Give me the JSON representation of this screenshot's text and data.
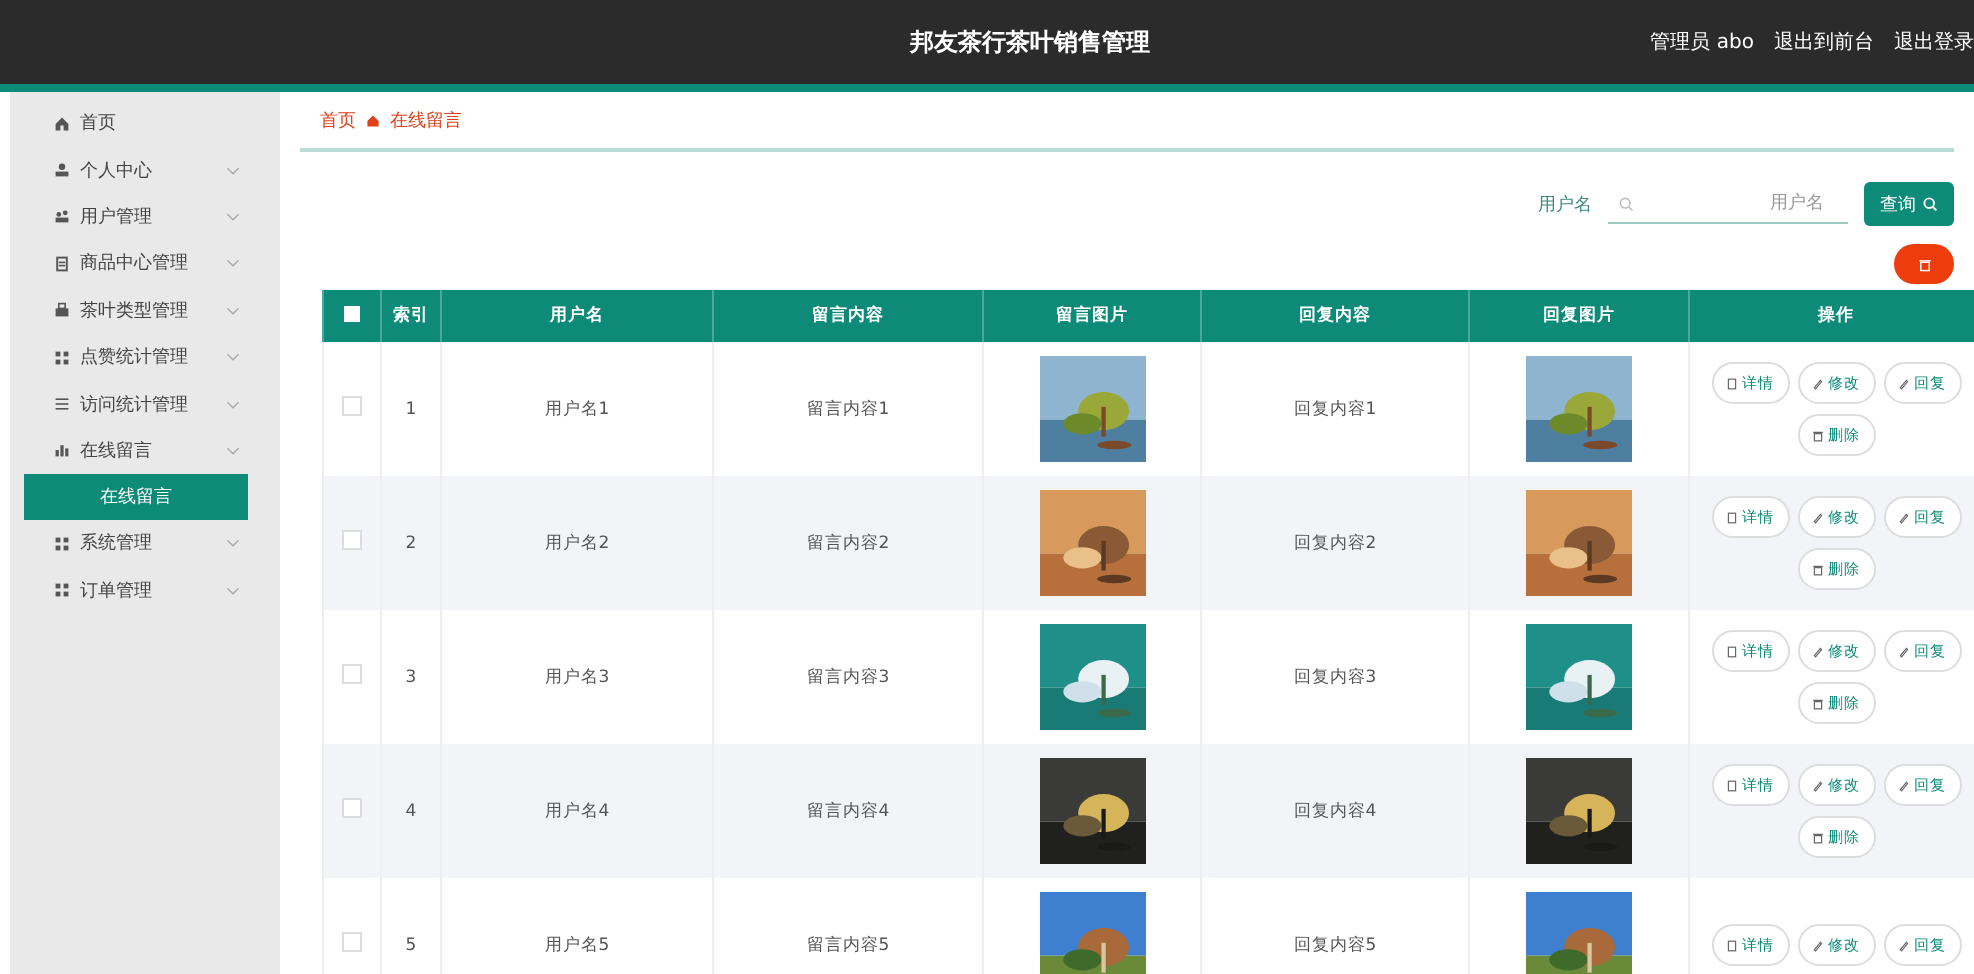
{
  "header": {
    "title": "邦友茶行茶叶销售管理",
    "links": [
      "管理员 abo",
      "退出到前台",
      "退出登录"
    ]
  },
  "sidebar": {
    "items": [
      {
        "label": "首页",
        "kind": "link"
      },
      {
        "label": "个人中心",
        "kind": "menu"
      },
      {
        "label": "用户管理",
        "kind": "menu"
      },
      {
        "label": "商品中心管理",
        "kind": "menu"
      },
      {
        "label": "茶叶类型管理",
        "kind": "menu"
      },
      {
        "label": "点赞统计管理",
        "kind": "menu"
      },
      {
        "label": "访问统计管理",
        "kind": "menu"
      },
      {
        "label": "在线留言",
        "kind": "menu",
        "children": [
          {
            "label": "在线留言",
            "selected": true
          }
        ]
      },
      {
        "label": "系统管理",
        "kind": "menu"
      },
      {
        "label": "订单管理",
        "kind": "menu"
      }
    ]
  },
  "breadcrumb": [
    "首页",
    "在线留言"
  ],
  "search": {
    "label": "用户名",
    "placeholder": "用户名",
    "button": "查询"
  },
  "table": {
    "header_checked": false,
    "columns": [
      "索引",
      "用户名",
      "留言内容",
      "留言图片",
      "回复内容",
      "回复图片",
      "操作"
    ],
    "rows": [
      {
        "checked": false,
        "index": "1",
        "user": "用户名1",
        "content": "留言内容1",
        "reply": "回复内容1",
        "actions": [
          "详情",
          "修改",
          "回复",
          "删除"
        ]
      },
      {
        "checked": false,
        "index": "2",
        "user": "用户名2",
        "content": "留言内容2",
        "reply": "回复内容2",
        "actions": [
          "详情",
          "修改",
          "回复",
          "删除"
        ]
      },
      {
        "checked": false,
        "index": "3",
        "user": "用户名3",
        "content": "留言内容3",
        "reply": "回复内容3",
        "actions": [
          "详情",
          "修改",
          "回复",
          "删除"
        ]
      },
      {
        "checked": false,
        "index": "4",
        "user": "用户名4",
        "content": "留言内容4",
        "reply": "回复内容4",
        "actions": [
          "详情",
          "修改",
          "回复",
          "删除"
        ]
      },
      {
        "checked": false,
        "index": "5",
        "user": "用户名5",
        "content": "留言内容5",
        "reply": "回复内容5",
        "actions": [
          "详情",
          "修改",
          "回复"
        ]
      }
    ]
  }
}
